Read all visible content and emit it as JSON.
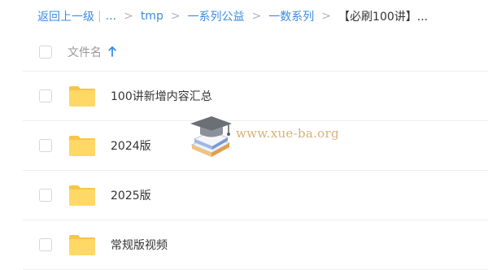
{
  "breadcrumb": {
    "back_label": "返回上一级",
    "pipe": "|",
    "ellipsis": "...",
    "separator": ">",
    "items": [
      "tmp",
      "一系列公益",
      "一数系列"
    ],
    "current": "【必刷100讲】..."
  },
  "list_header": {
    "name_label": "文件名",
    "sort_icon": "arrow-up-icon"
  },
  "files": [
    {
      "name": "100讲新增内容汇总",
      "icon": "folder-icon"
    },
    {
      "name": "2024版",
      "icon": "folder-icon"
    },
    {
      "name": "2025版",
      "icon": "folder-icon"
    },
    {
      "name": "常规版视频",
      "icon": "folder-icon"
    }
  ],
  "watermark": {
    "text": "www.xue-ba.org",
    "icon": "graduation-cap-icon"
  },
  "colors": {
    "link": "#3b8ce0",
    "folder": "#ffd866",
    "folder_tab": "#f7c548",
    "border": "#eeeeee",
    "header_text": "#999999"
  }
}
